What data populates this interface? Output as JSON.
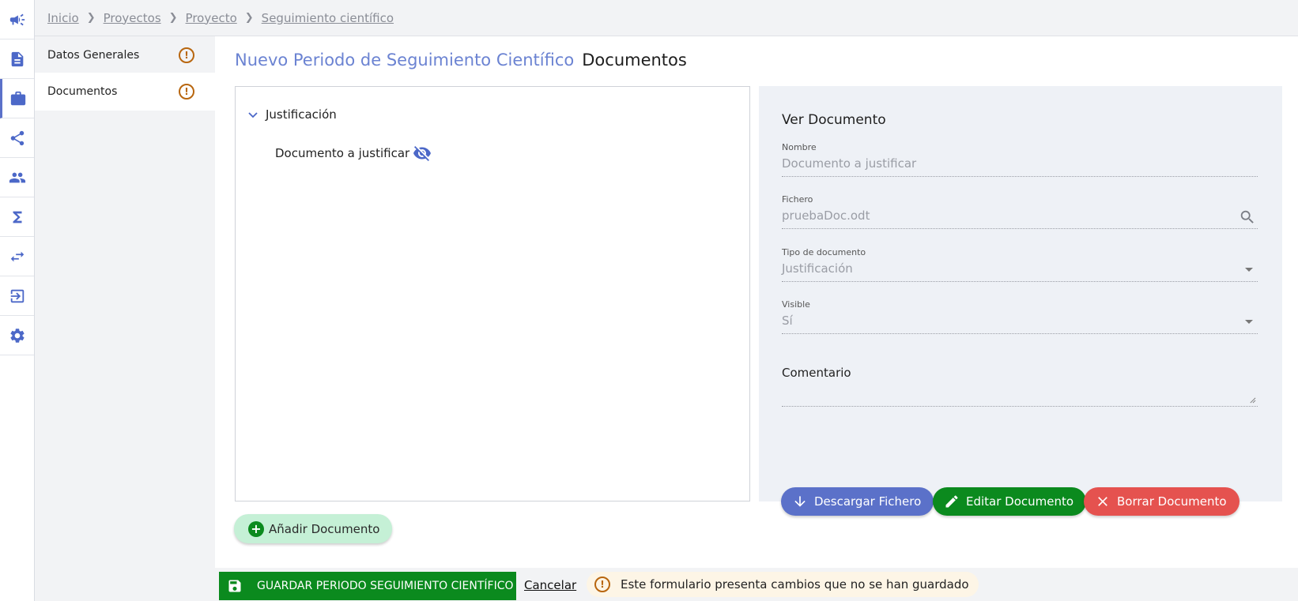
{
  "rail": {
    "items": [
      {
        "icon": "megaphone-icon"
      },
      {
        "icon": "document-icon"
      },
      {
        "icon": "briefcase-icon"
      },
      {
        "icon": "share-icon"
      },
      {
        "icon": "people-icon"
      },
      {
        "icon": "sigma-icon"
      },
      {
        "icon": "swap-arrows-icon"
      },
      {
        "icon": "logout-icon"
      },
      {
        "icon": "gear-icon"
      }
    ],
    "active_index": 2
  },
  "breadcrumb": {
    "items": [
      "Inicio",
      "Proyectos",
      "Proyecto",
      "Seguimiento científico"
    ]
  },
  "subnav": {
    "items": [
      {
        "label": "Datos Generales",
        "warning": "!"
      },
      {
        "label": "Documentos",
        "warning": "!"
      }
    ],
    "active_index": 1
  },
  "main": {
    "title": "Nuevo Periodo de Seguimiento Científico",
    "subtitle": "Documentos"
  },
  "tree": {
    "node_label": "Justificación",
    "leaf_label": "Documento a justificar"
  },
  "doc": {
    "title": "Ver Documento",
    "nombre_label": "Nombre",
    "nombre_value": "Documento a justificar",
    "fichero_label": "Fichero",
    "fichero_value": "pruebaDoc.odt",
    "tipo_label": "Tipo de documento",
    "tipo_value": "Justificación",
    "visible_label": "Visible",
    "visible_value": "Sí",
    "comentario_label": "Comentario"
  },
  "actions": {
    "download": "Descargar Fichero",
    "edit": "Editar Documento",
    "delete": "Borrar Documento",
    "add": "Añadir Documento"
  },
  "footer": {
    "save": "GUARDAR PERIODO SEGUIMIENTO CIENTÍFICO",
    "cancel": "Cancelar",
    "unsaved_warning": "Este formulario presenta cambios que no se han guardado"
  },
  "colors": {
    "accent": "#5b71c9",
    "green": "#0b8a1e",
    "red": "#e5524f",
    "warning": "#b8660f"
  }
}
